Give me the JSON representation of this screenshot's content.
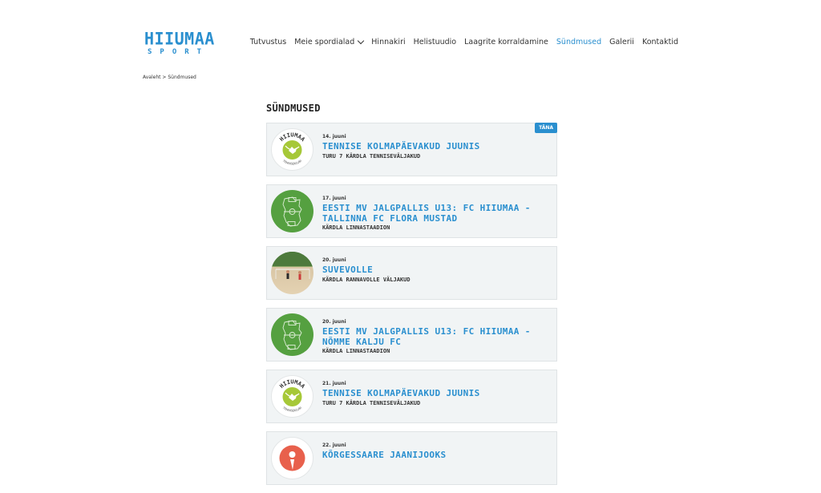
{
  "logo": {
    "main": "HIIUMAA",
    "sub": "SPORT"
  },
  "nav": {
    "items": [
      {
        "label": "Tutvustus",
        "name": "nav-tutvustus"
      },
      {
        "label": "Meie spordialad",
        "name": "nav-meie-spordialad",
        "dropdown": true
      },
      {
        "label": "Hinnakiri",
        "name": "nav-hinnakiri"
      },
      {
        "label": "Helistuudio",
        "name": "nav-helistuudio"
      },
      {
        "label": "Laagrite korraldamine",
        "name": "nav-laagrite-korraldamine"
      },
      {
        "label": "Sündmused",
        "name": "nav-sundmused",
        "active": true
      },
      {
        "label": "Galerii",
        "name": "nav-galerii"
      },
      {
        "label": "Kontaktid",
        "name": "nav-kontaktid"
      }
    ]
  },
  "breadcrumb": {
    "home": "Avaleht",
    "sep": " > ",
    "current": "Sündmused"
  },
  "page_title": "SÜNDMUSED",
  "events": [
    {
      "date": "14. juuni",
      "title": "Tennise kolmapäevakud juunis",
      "venue": "Turu 7 Kärdla tenniseväljakud",
      "thumb": "tennis-club-logo",
      "badge": "TÄNA"
    },
    {
      "date": "17. juuni",
      "title": "EESTI MV JALGPALLIS U13: FC HIIUMAA - TALLINNA FC FLORA MUSTAD",
      "venue": "Kärdla linnastaadion",
      "thumb": "football-field-icon"
    },
    {
      "date": "20. juuni",
      "title": "Suvevolle",
      "venue": "Kärdla rannavolle väljakud",
      "thumb": "beach-volleyball-photo"
    },
    {
      "date": "20. juuni",
      "title": "EESTI MV JALGPALLIS U13: FC HIIUMAA - NÕMME KALJU FC",
      "venue": "Kärdla linnastaadion",
      "thumb": "football-field-icon"
    },
    {
      "date": "21. juuni",
      "title": "Tennise kolmapäevakud juunis",
      "venue": "Turu 7 Kärdla tenniseväljakud",
      "thumb": "tennis-club-logo"
    },
    {
      "date": "22. juuni",
      "title": "Kõrgessaare jaanijooks",
      "venue": "",
      "thumb": "runner-icon"
    }
  ],
  "thumb_text": {
    "tennis_top": "HIIUMAA",
    "tennis_bottom": "TENNISEKLUBI"
  },
  "colors": {
    "accent": "#2a8fcf",
    "field": "#55a040",
    "card_bg": "#f1f4f5",
    "runner": "#e8604c"
  }
}
